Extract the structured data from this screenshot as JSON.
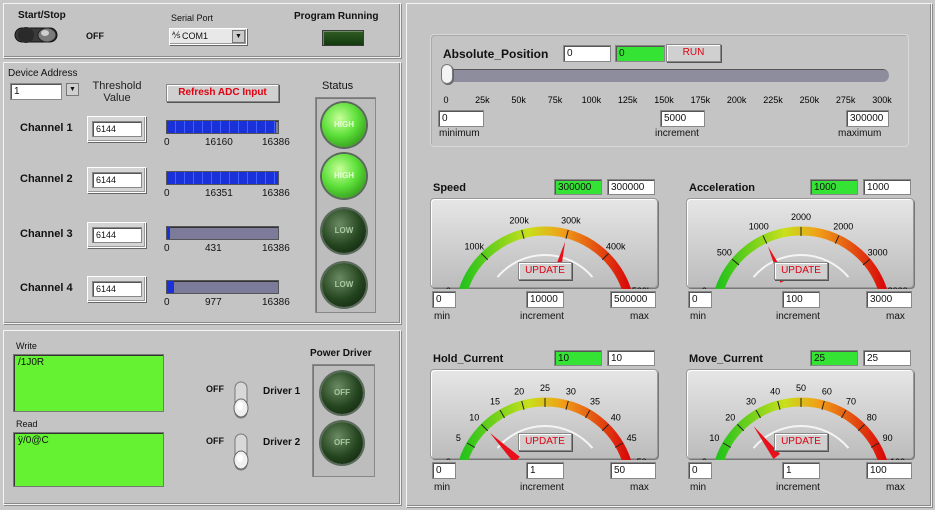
{
  "top": {
    "start_stop": "Start/Stop",
    "toggle_state": "OFF",
    "serial_port_label": "Serial Port",
    "serial_port_value": "COM1",
    "program_running": "Program Running"
  },
  "adc": {
    "device_address_label": "Device Address",
    "device_address_value": "1",
    "threshold_label": "Threshold Value",
    "refresh_button": "Refresh ADC Input",
    "status_label": "Status",
    "channels": [
      {
        "name": "Channel 1",
        "threshold": "6144",
        "value": "16160",
        "max": "16386",
        "min": "0",
        "fraction": 0.986,
        "status": "HIGH",
        "on": true
      },
      {
        "name": "Channel 2",
        "threshold": "6144",
        "value": "16351",
        "max": "16386",
        "min": "0",
        "fraction": 0.998,
        "status": "HIGH",
        "on": true
      },
      {
        "name": "Channel 3",
        "threshold": "6144",
        "value": "431",
        "max": "16386",
        "min": "0",
        "fraction": 0.026,
        "status": "LOW",
        "on": false
      },
      {
        "name": "Channel 4",
        "threshold": "6144",
        "value": "977",
        "max": "16386",
        "min": "0",
        "fraction": 0.06,
        "status": "LOW",
        "on": false
      }
    ]
  },
  "io": {
    "write_label": "Write",
    "write_value": "/1J0R",
    "read_label": "Read",
    "read_value": "ÿ/0@C",
    "power_driver_label": "Power Driver",
    "driver1_label": "Driver 1",
    "driver2_label": "Driver 2",
    "driver1_state": "OFF",
    "driver2_state": "OFF",
    "driver1_led": "OFF",
    "driver2_led": "OFF"
  },
  "position": {
    "label": "Absolute_Position",
    "value1": "0",
    "value2": "0",
    "run_button": "RUN",
    "scale": [
      "0",
      "25k",
      "50k",
      "75k",
      "100k",
      "125k",
      "150k",
      "175k",
      "200k",
      "225k",
      "250k",
      "275k",
      "300k"
    ],
    "minimum": "0",
    "minimum_label": "minimum",
    "increment": "5000",
    "increment_label": "increment",
    "maximum": "300000",
    "maximum_label": "maximum",
    "slider_fraction": 0
  },
  "gauges": {
    "speed": {
      "title": "Speed",
      "indicator": "300000",
      "control": "300000",
      "scale": [
        "0",
        "100k",
        "200k",
        "300k",
        "400k",
        "500k"
      ],
      "needle_fraction": 0.6,
      "update": "UPDATE",
      "min": "0",
      "increment": "10000",
      "max": "500000",
      "min_label": "min",
      "increment_label": "increment",
      "max_label": "max"
    },
    "acceleration": {
      "title": "Acceleration",
      "indicator": "1000",
      "control": "1000",
      "scale": [
        "0",
        "500",
        "1000",
        "2000",
        "2000",
        "3000",
        "3000"
      ],
      "needle_fraction": 0.333,
      "update": "UPDATE",
      "min": "0",
      "increment": "100",
      "max": "3000",
      "min_label": "min",
      "increment_label": "increment",
      "max_label": "max"
    },
    "hold_current": {
      "title": "Hold_Current",
      "indicator": "10",
      "control": "10",
      "scale": [
        "0",
        "5",
        "10",
        "15",
        "20",
        "25",
        "30",
        "35",
        "40",
        "45",
        "50"
      ],
      "needle_fraction": 0.2,
      "update": "UPDATE",
      "min": "0",
      "increment": "1",
      "max": "50",
      "min_label": "min",
      "increment_label": "increment",
      "max_label": "max"
    },
    "move_current": {
      "title": "Move_Current",
      "indicator": "25",
      "control": "25",
      "scale": [
        "0",
        "10",
        "20",
        "30",
        "40",
        "50",
        "60",
        "70",
        "80",
        "90",
        "100"
      ],
      "needle_fraction": 0.25,
      "update": "UPDATE",
      "min": "0",
      "increment": "1",
      "max": "100",
      "min_label": "min",
      "increment_label": "increment",
      "max_label": "max"
    }
  },
  "colors": {
    "indicator_green": "#35e335",
    "led_on": "#5de03a",
    "led_off": "#24441f",
    "bar_fill": "#1f3fe0",
    "button_text": "#e00010"
  }
}
